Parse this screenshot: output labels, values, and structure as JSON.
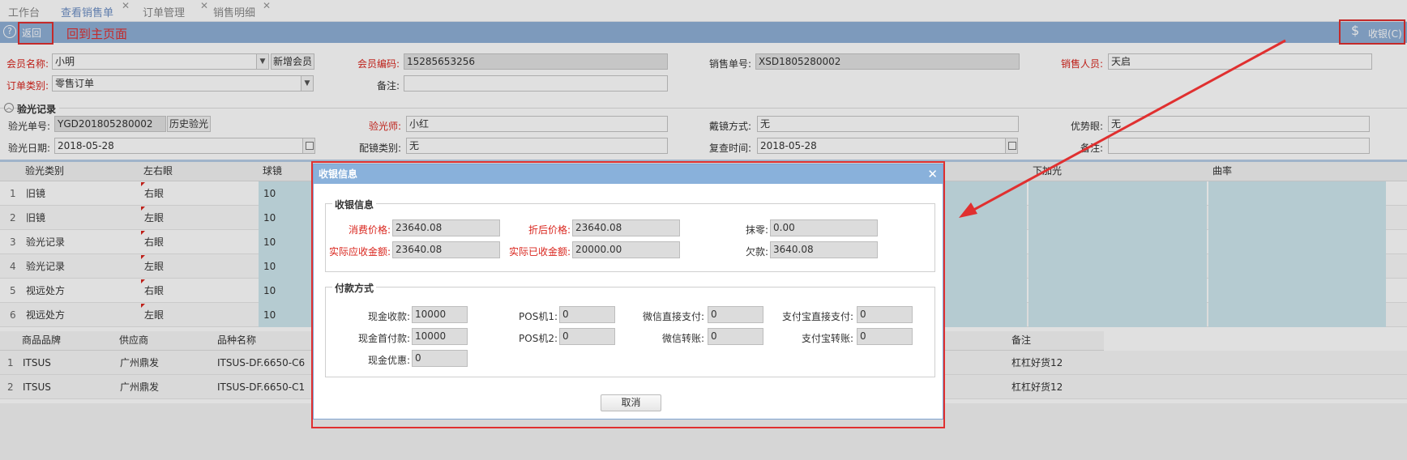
{
  "tabs": [
    {
      "label": "工作台"
    },
    {
      "label": "查看销售单"
    },
    {
      "label": "订单管理"
    },
    {
      "label": "销售明细"
    }
  ],
  "toolbar": {
    "back_label": "返回",
    "annotation_back": "回到主页面",
    "cashier_label": "收银(C)"
  },
  "member": {
    "name_label": "会员名称:",
    "name_value": "小明",
    "new_member_label": "新增会员",
    "code_label": "会员编码:",
    "code_value": "15285653256",
    "sale_no_label": "销售单号:",
    "sale_no_value": "XSD1805280002",
    "seller_label": "销售人员:",
    "seller_value": "天启",
    "order_type_label": "订单类别:",
    "order_type_value": "零售订单",
    "remark_label": "备注:",
    "remark_value": ""
  },
  "optometry": {
    "section_label": "验光记录",
    "no_label": "验光单号:",
    "no_value": "YGD201805280002",
    "history_label": "历史验光",
    "optometrist_label": "验光师:",
    "optometrist_value": "小红",
    "wear_label": "戴镜方式:",
    "wear_value": "无",
    "dominant_label": "优势眼:",
    "dominant_value": "无",
    "date_label": "验光日期:",
    "date_value": "2018-05-28",
    "lens_type_label": "配镜类别:",
    "lens_type_value": "无",
    "recheck_label": "复查时间:",
    "recheck_value": "2018-05-28",
    "remark_label": "备注:",
    "remark_value": ""
  },
  "grid1": {
    "headers": [
      "验光类别",
      "左右眼",
      "球镜",
      "下加光",
      "曲率"
    ],
    "rows": [
      {
        "n": "1",
        "type": "旧镜",
        "eye": "右眼",
        "sph": "10"
      },
      {
        "n": "2",
        "type": "旧镜",
        "eye": "左眼",
        "sph": "10"
      },
      {
        "n": "3",
        "type": "验光记录",
        "eye": "右眼",
        "sph": "10"
      },
      {
        "n": "4",
        "type": "验光记录",
        "eye": "左眼",
        "sph": "10"
      },
      {
        "n": "5",
        "type": "视远处方",
        "eye": "右眼",
        "sph": "10"
      },
      {
        "n": "6",
        "type": "视远处方",
        "eye": "左眼",
        "sph": "10"
      }
    ]
  },
  "grid2": {
    "headers": [
      "商品品牌",
      "供应商",
      "品种名称",
      "备注"
    ],
    "rows": [
      {
        "n": "1",
        "brand": "ITSUS",
        "supplier": "广州鼎发",
        "variety": "ITSUS-DF.6650-C6",
        "remark": "杠杠好货12"
      },
      {
        "n": "2",
        "brand": "ITSUS",
        "supplier": "广州鼎发",
        "variety": "ITSUS-DF.6650-C1",
        "remark": "杠杠好货12"
      }
    ]
  },
  "dialog": {
    "title": "收银信息",
    "cashier_section": "收银信息",
    "consume_label": "消费价格:",
    "consume_value": "23640.08",
    "discount_label": "折后价格:",
    "discount_value": "23640.08",
    "zero_label": "抹零:",
    "zero_value": "0.00",
    "due_label": "实际应收金额:",
    "due_value": "23640.08",
    "received_label": "实际已收金额:",
    "received_value": "20000.00",
    "owed_label": "欠款:",
    "owed_value": "3640.08",
    "payment_section": "付款方式",
    "cash_label": "现金收款:",
    "cash_value": "10000",
    "pos1_label": "POS机1:",
    "pos1_value": "0",
    "wechat_direct_label": "微信直接支付:",
    "wechat_direct_value": "0",
    "alipay_direct_label": "支付宝直接支付:",
    "alipay_direct_value": "0",
    "cash_first_label": "现金首付款:",
    "cash_first_value": "10000",
    "pos2_label": "POS机2:",
    "pos2_value": "0",
    "wechat_transfer_label": "微信转账:",
    "wechat_transfer_value": "0",
    "alipay_transfer_label": "支付宝转账:",
    "alipay_transfer_value": "0",
    "cash_discount_label": "现金优惠:",
    "cash_discount_value": "0",
    "cancel_label": "取消"
  },
  "colors": {
    "accent": "#8fb0d7",
    "annotation_red": "#e03030",
    "required_label": "#d9251d",
    "grid_teal": "#cfe7ee"
  }
}
